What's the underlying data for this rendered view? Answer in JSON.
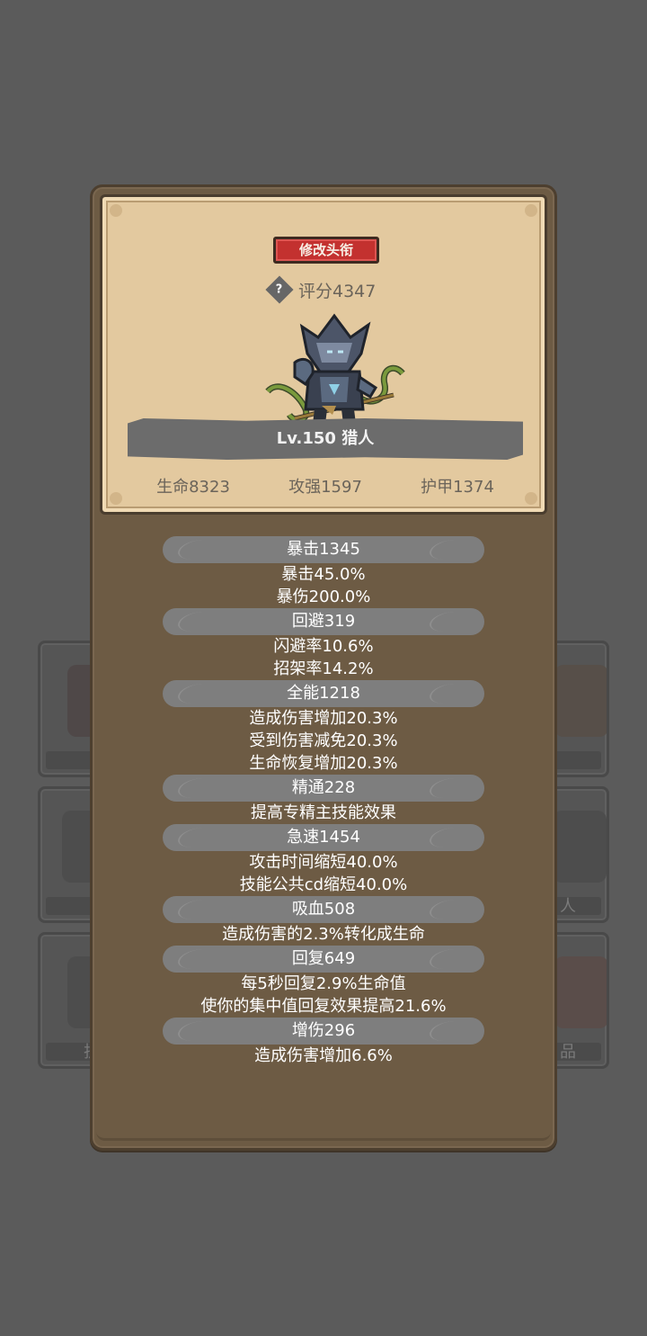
{
  "background": {
    "tiles": [
      {
        "label": ""
      },
      {
        "label": ""
      },
      {
        "label": ""
      },
      {
        "label": "人"
      },
      {
        "label": "护"
      },
      {
        "label": "品"
      }
    ]
  },
  "profile": {
    "edit_title_button": "修改头衔",
    "help_symbol": "?",
    "score": "评分4347",
    "character_art_icon": "hunter-character-sprite",
    "name": "Lv.150 猎人",
    "hp": "生命8323",
    "attack": "攻强1597",
    "armor": "护甲1374"
  },
  "attributes": [
    {
      "header": "暴击1345",
      "lines": [
        "暴击45.0%",
        "暴伤200.0%"
      ]
    },
    {
      "header": "回避319",
      "lines": [
        "闪避率10.6%",
        "招架率14.2%"
      ]
    },
    {
      "header": "全能1218",
      "lines": [
        "造成伤害增加20.3%",
        "受到伤害减免20.3%",
        "生命恢复增加20.3%"
      ]
    },
    {
      "header": "精通228",
      "lines": [
        "提高专精主技能效果"
      ]
    },
    {
      "header": "急速1454",
      "lines": [
        "攻击时间缩短40.0%",
        "技能公共cd缩短40.0%"
      ]
    },
    {
      "header": "吸血508",
      "lines": [
        "造成伤害的2.3%转化成生命"
      ]
    },
    {
      "header": "回复649",
      "lines": [
        "每5秒回复2.9%生命值",
        "使你的集中值回复效果提高21.6%"
      ]
    },
    {
      "header": "增伤296",
      "lines": [
        "造成伤害增加6.6%"
      ]
    }
  ],
  "colors": {
    "parchment": "#e3c99f",
    "panel": "#6d5b44",
    "button_red": "#c3312f",
    "attr_header": "#7e7e7e"
  }
}
